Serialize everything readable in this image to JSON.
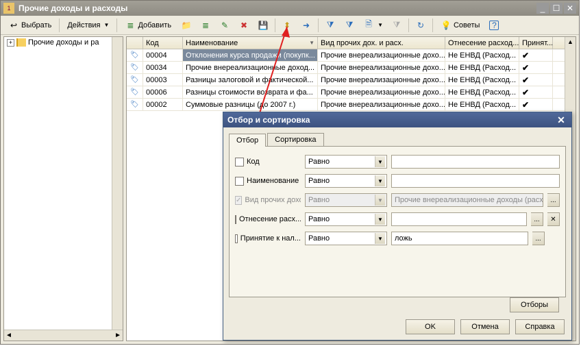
{
  "window": {
    "title": "Прочие доходы и расходы"
  },
  "toolbar": {
    "choose": "Выбрать",
    "actions": "Действия",
    "add": "Добавить",
    "tips": "Советы"
  },
  "tree": {
    "root": "Прочие доходы и ра"
  },
  "grid": {
    "cols": {
      "blank": "",
      "code": "Код",
      "name": "Наименование",
      "kind": "Вид прочих дох. и расх.",
      "expense": "Отнесение расход...",
      "accept": "Принят..."
    },
    "rows": [
      {
        "code": "00004",
        "name": "Отклонения курса продажи (покупк...",
        "kind": "Прочие внереализационные дохо...",
        "exp": "Не ЕНВД (Расход...",
        "acc": "✔",
        "sel": true
      },
      {
        "code": "00034",
        "name": "Прочие внереализационные доход...",
        "kind": "Прочие внереализационные дохо...",
        "exp": "Не ЕНВД (Расход...",
        "acc": "✔"
      },
      {
        "code": "00003",
        "name": "Разницы залоговой и фактической...",
        "kind": "Прочие внереализационные дохо...",
        "exp": "Не ЕНВД (Расход...",
        "acc": "✔"
      },
      {
        "code": "00006",
        "name": "Разницы стоимости возврата и фа...",
        "kind": "Прочие внереализационные дохо...",
        "exp": "Не ЕНВД (Расход...",
        "acc": "✔"
      },
      {
        "code": "00002",
        "name": "Суммовые разницы (до 2007 г.)",
        "kind": "Прочие внереализационные дохо...",
        "exp": "Не ЕНВД (Расход...",
        "acc": "✔"
      }
    ]
  },
  "dialog": {
    "title": "Отбор и сортировка",
    "tabs": {
      "filter": "Отбор",
      "sort": "Сортировка"
    },
    "fields": {
      "code": "Код",
      "name": "Наименование",
      "kind": "Вид прочих дохо...",
      "expense": "Отнесение расх...",
      "accept": "Принятие к нал..."
    },
    "op": "Равно",
    "val_kind": "Прочие внереализационные доходы (расхо...",
    "val_accept": "ложь",
    "btn_filters": "Отборы",
    "btn_ok": "OK",
    "btn_cancel": "Отмена",
    "btn_help": "Справка"
  }
}
